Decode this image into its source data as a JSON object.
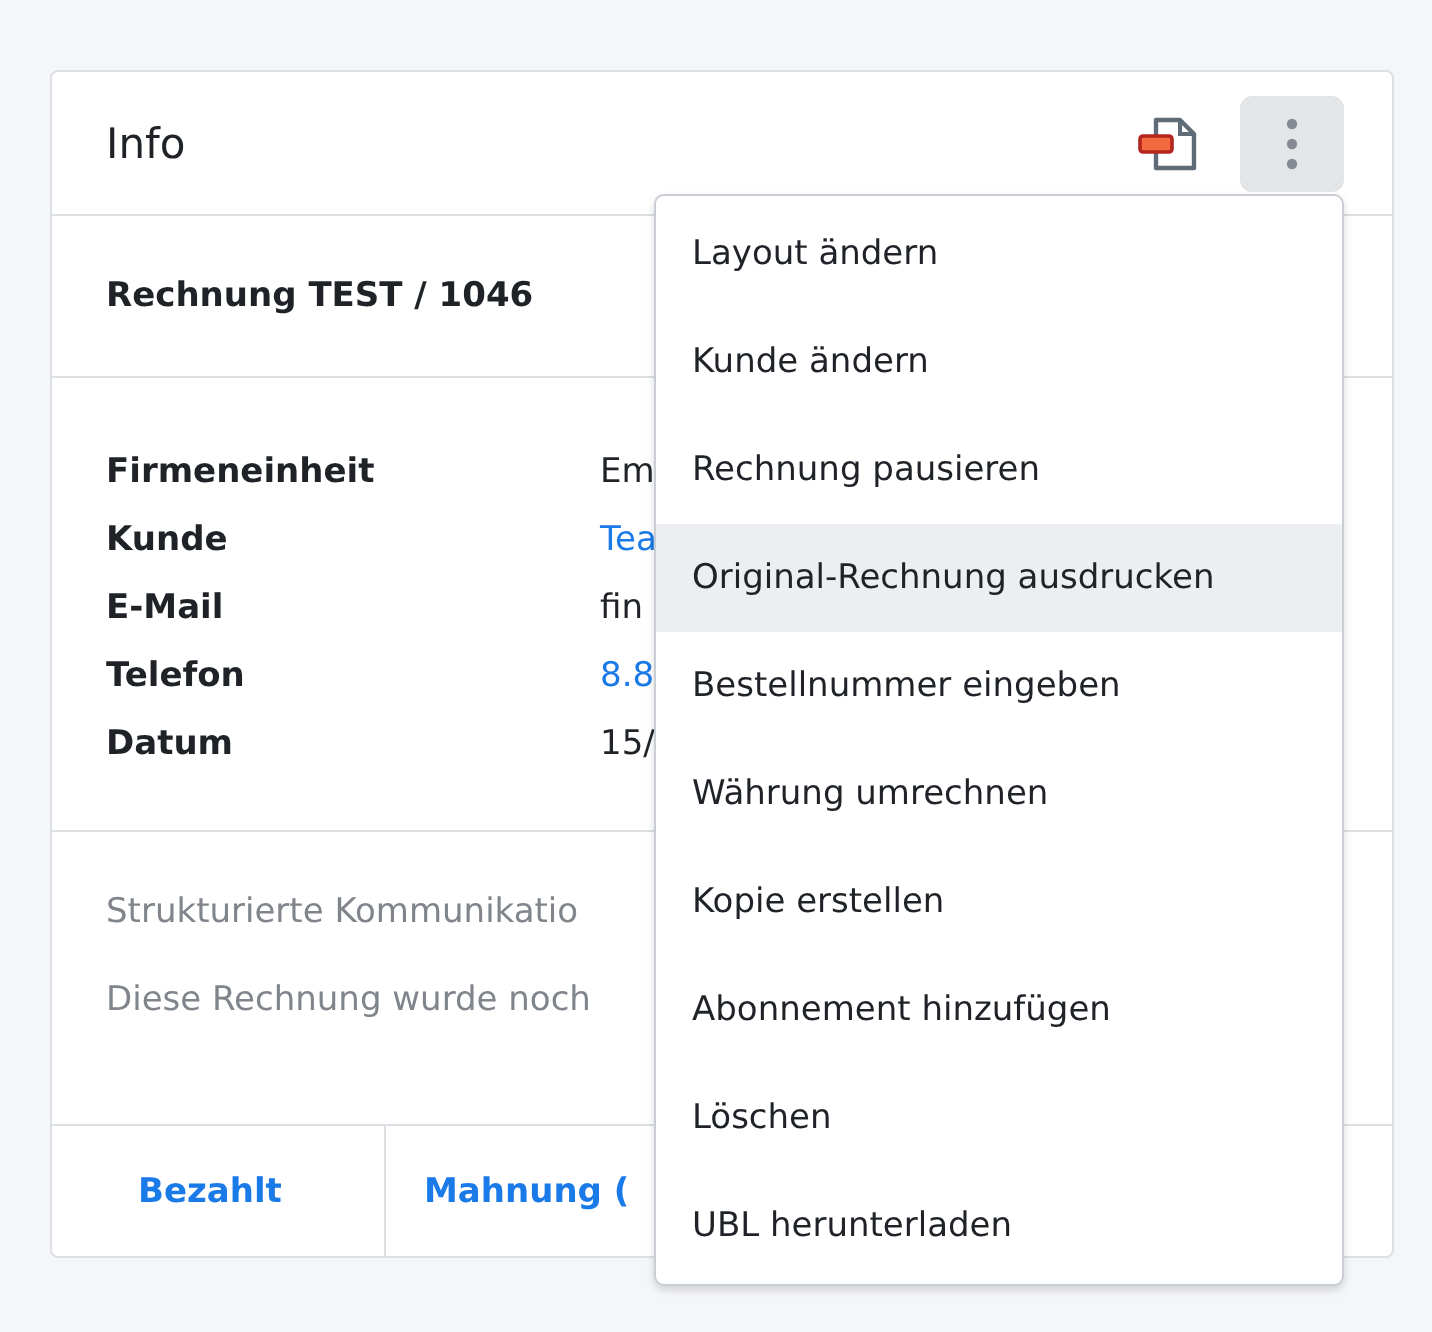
{
  "card": {
    "title": "Info",
    "invoice": "Rechnung TEST / 1046",
    "details": [
      {
        "label": "Firmeneinheit",
        "value": "Em",
        "link": false
      },
      {
        "label": "Kunde",
        "value": "Tea",
        "link": true
      },
      {
        "label": "E-Mail",
        "value": "fin",
        "link": false
      },
      {
        "label": "Telefon",
        "value": "8.8",
        "link": true
      },
      {
        "label": "Datum",
        "value": "15/",
        "link": false
      }
    ],
    "notes": [
      "Strukturierte Kommunikatio",
      "Diese Rechnung wurde noch"
    ],
    "actions": [
      "Bezahlt",
      "Mahnung ("
    ]
  },
  "menu": {
    "items": [
      {
        "label": "Layout ändern",
        "highlighted": false
      },
      {
        "label": "Kunde ändern",
        "highlighted": false
      },
      {
        "label": "Rechnung pausieren",
        "highlighted": false
      },
      {
        "label": "Original-Rechnung ausdrucken",
        "highlighted": true
      },
      {
        "label": "Bestellnummer eingeben",
        "highlighted": false
      },
      {
        "label": "Währung umrechnen",
        "highlighted": false
      },
      {
        "label": "Kopie erstellen",
        "highlighted": false
      },
      {
        "label": "Abonnement hinzufügen",
        "highlighted": false
      },
      {
        "label": "Löschen",
        "highlighted": false
      },
      {
        "label": "UBL herunterladen",
        "highlighted": false
      }
    ]
  }
}
